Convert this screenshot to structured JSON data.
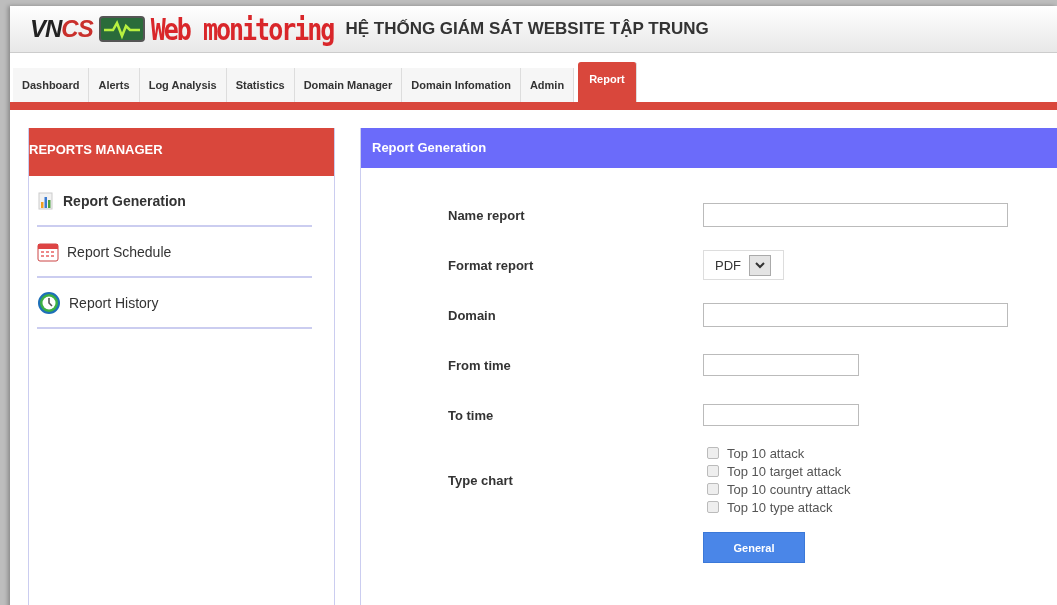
{
  "header": {
    "logo_text": "VN",
    "logo_text_2": "CS",
    "title": "Web monitoring",
    "subtitle": "HỆ THỐNG GIÁM SÁT WEBSITE TẬP TRUNG"
  },
  "tabs": [
    {
      "label": "Dashboard",
      "selected": false
    },
    {
      "label": "Alerts",
      "selected": false
    },
    {
      "label": "Log Analysis",
      "selected": false
    },
    {
      "label": "Statistics",
      "selected": false
    },
    {
      "label": "Domain Manager",
      "selected": false
    },
    {
      "label": "Domain Infomation",
      "selected": false
    },
    {
      "label": "Admin",
      "selected": false
    },
    {
      "label": "Report",
      "selected": true
    }
  ],
  "sidebar": {
    "title": "REPORTS MANAGER",
    "items": [
      {
        "label": "Report Generation",
        "selected": true
      },
      {
        "label": "Report Schedule",
        "selected": false
      },
      {
        "label": "Report History",
        "selected": false
      }
    ]
  },
  "form": {
    "title": "Report Generation",
    "fields": [
      {
        "kind": "text",
        "label": "Name report"
      },
      {
        "kind": "select",
        "label": "Format report",
        "value": "PDF"
      },
      {
        "kind": "text",
        "label": "Domain"
      },
      {
        "kind": "time",
        "label": "From time"
      },
      {
        "kind": "time",
        "label": "To time"
      },
      {
        "kind": "checklist",
        "label": "Type chart",
        "options": [
          {
            "label": "Top 10 attack",
            "checked": false
          },
          {
            "label": "Top 10 target attack",
            "checked": false
          },
          {
            "label": "Top 10 country attack",
            "checked": false
          },
          {
            "label": "Top 10 type attack",
            "checked": false
          }
        ]
      }
    ],
    "button": "General"
  }
}
